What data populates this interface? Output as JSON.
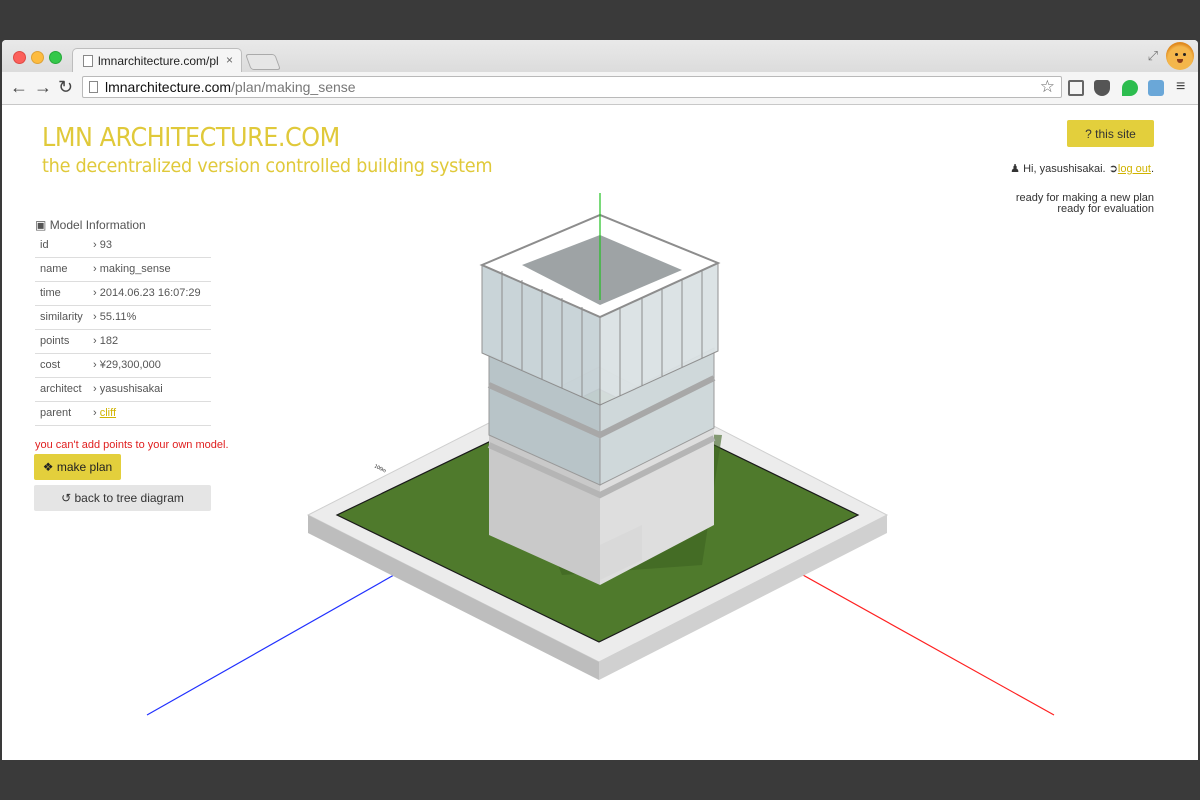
{
  "browser": {
    "tab_title": "lmnarchitecture.com/plan/",
    "tab_close": "×",
    "url_host": "lmnarchitecture.com",
    "url_path": "/plan/making_sense",
    "star": "☆",
    "menu": "≡",
    "back": "←",
    "forward": "→",
    "reload": "↻",
    "resize": "⤢"
  },
  "header": {
    "title": "LMN ARCHITECTURE.COM",
    "subtitle": "the decentralized version controlled building system",
    "this_site_button": "? this site"
  },
  "user": {
    "greeting": "Hi, yasushisakai.",
    "logout": "log out",
    "period": "."
  },
  "status": {
    "line1": "ready for making a new plan",
    "line2": "ready for evaluation"
  },
  "model_info": {
    "heading": "Model Information",
    "rows": [
      {
        "key": "id",
        "value": "93"
      },
      {
        "key": "name",
        "value": "making_sense"
      },
      {
        "key": "time",
        "value": "2014.06.23 16:07:29"
      },
      {
        "key": "similarity",
        "value": "55.11%"
      },
      {
        "key": "points",
        "value": "182"
      },
      {
        "key": "cost",
        "value": "¥29,300,000"
      },
      {
        "key": "architect",
        "value": "yasushisakai"
      },
      {
        "key": "parent",
        "value": "cliff"
      }
    ]
  },
  "warning": "you can't add points to your own model.",
  "buttons": {
    "make_plan": "make plan",
    "back_to_tree": "back to tree diagram"
  },
  "colors": {
    "accent": "#e3cf3c",
    "title": "#e0c93a",
    "warning": "#e02020",
    "axis_x": "#ff2020",
    "axis_y": "#20c020",
    "axis_z": "#2030ff",
    "grass": "#4f7a2c"
  }
}
